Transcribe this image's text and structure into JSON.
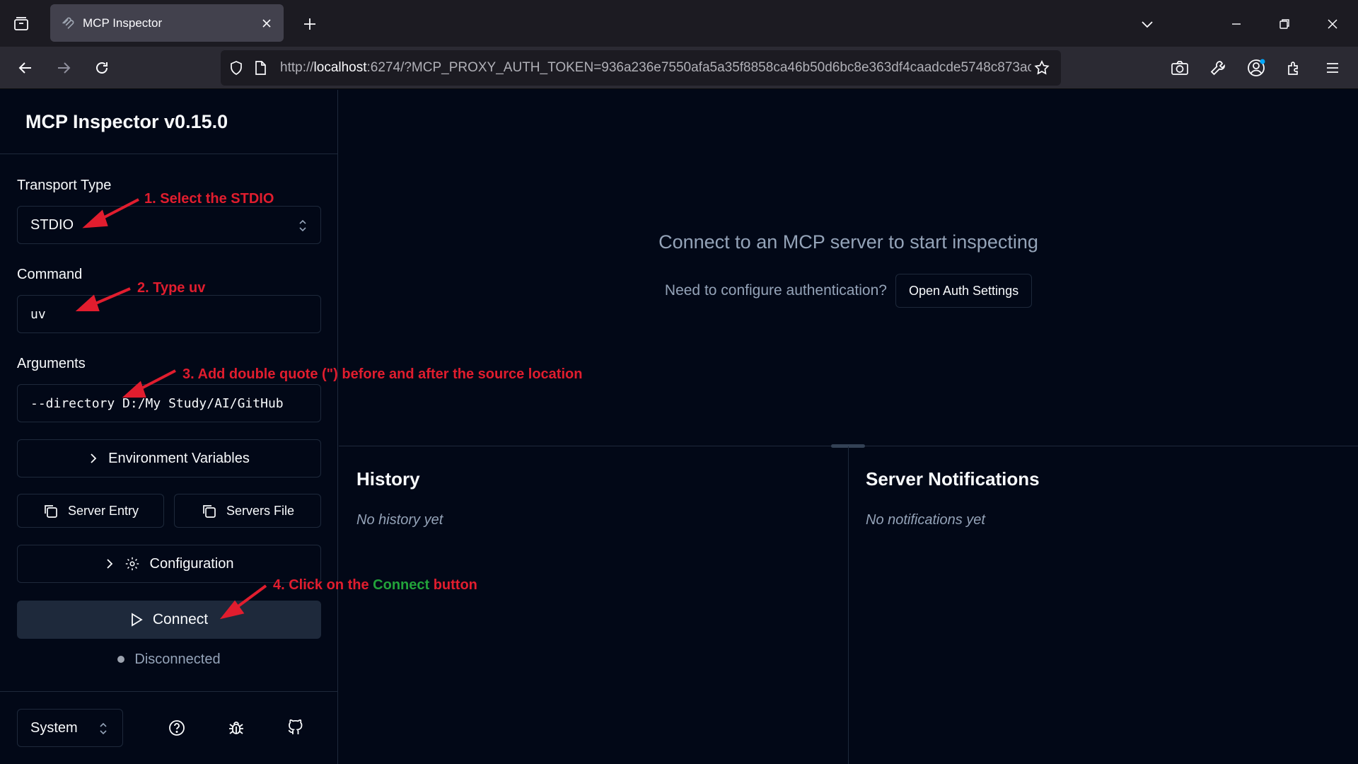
{
  "browser": {
    "tab_title": "MCP Inspector",
    "url_prefix": "http://",
    "url_host": "localhost",
    "url_rest": ":6274/?MCP_PROXY_AUTH_TOKEN=936a236e7550afa5a35f8858ca46b50d6bc8e363df4caadcde5748c873ac"
  },
  "sidebar": {
    "app_title": "MCP Inspector v0.15.0",
    "transport_label": "Transport Type",
    "transport_value": "STDIO",
    "command_label": "Command",
    "command_value": "uv",
    "arguments_label": "Arguments",
    "arguments_value": "--directory D:/My Study/AI/GitHub",
    "env_button": "Environment Variables",
    "server_entry_button": "Server Entry",
    "servers_file_button": "Servers File",
    "configuration_button": "Configuration",
    "connect_button": "Connect",
    "status_text": "Disconnected",
    "theme_value": "System"
  },
  "annotations": {
    "step1": "1. Select the STDIO",
    "step2": "2. Type uv",
    "step3": "3. Add double quote (\") before and after the source location",
    "step4_prefix": "4. Click on the ",
    "step4_highlight": "Connect",
    "step4_suffix": " button"
  },
  "main": {
    "connect_message": "Connect to an MCP server to start inspecting",
    "auth_question": "Need to configure authentication?",
    "auth_button": "Open Auth Settings",
    "history_title": "History",
    "history_empty": "No history yet",
    "notifications_title": "Server Notifications",
    "notifications_empty": "No notifications yet"
  },
  "colors": {
    "background": "#020817",
    "border": "#1e293b",
    "annotation_red": "#e11d2e",
    "annotation_green": "#22a33a"
  },
  "icons": [
    "tab-list-icon",
    "mcp-favicon",
    "close-icon",
    "plus-icon",
    "chevron-down-icon",
    "minimize-icon",
    "restore-icon",
    "back-icon",
    "forward-icon",
    "reload-icon",
    "shield-icon",
    "page-icon",
    "star-icon",
    "camera-icon",
    "wrench-icon",
    "account-icon",
    "extensions-icon",
    "menu-icon",
    "chevron-updown-icon",
    "chevron-right-icon",
    "copy-icon",
    "gear-icon",
    "play-icon",
    "help-icon",
    "bug-icon",
    "github-icon"
  ]
}
